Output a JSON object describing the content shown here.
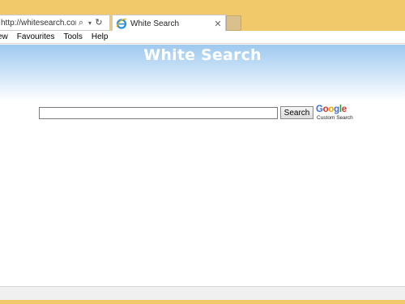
{
  "browser": {
    "address": "http://whitesearch.com/",
    "tab_title": "White Search",
    "menu": [
      "ew",
      "Favourites",
      "Tools",
      "Help"
    ]
  },
  "page": {
    "title": "White Search",
    "search_button": "Search",
    "google_logo": {
      "G": "G",
      "o1": "o",
      "o2": "o",
      "g": "g",
      "l": "l",
      "e": "e"
    },
    "custom_search": "Custom Search"
  },
  "colors": {
    "frame": "#f2c96a",
    "header_gradient_top": "#9fc9ef"
  }
}
